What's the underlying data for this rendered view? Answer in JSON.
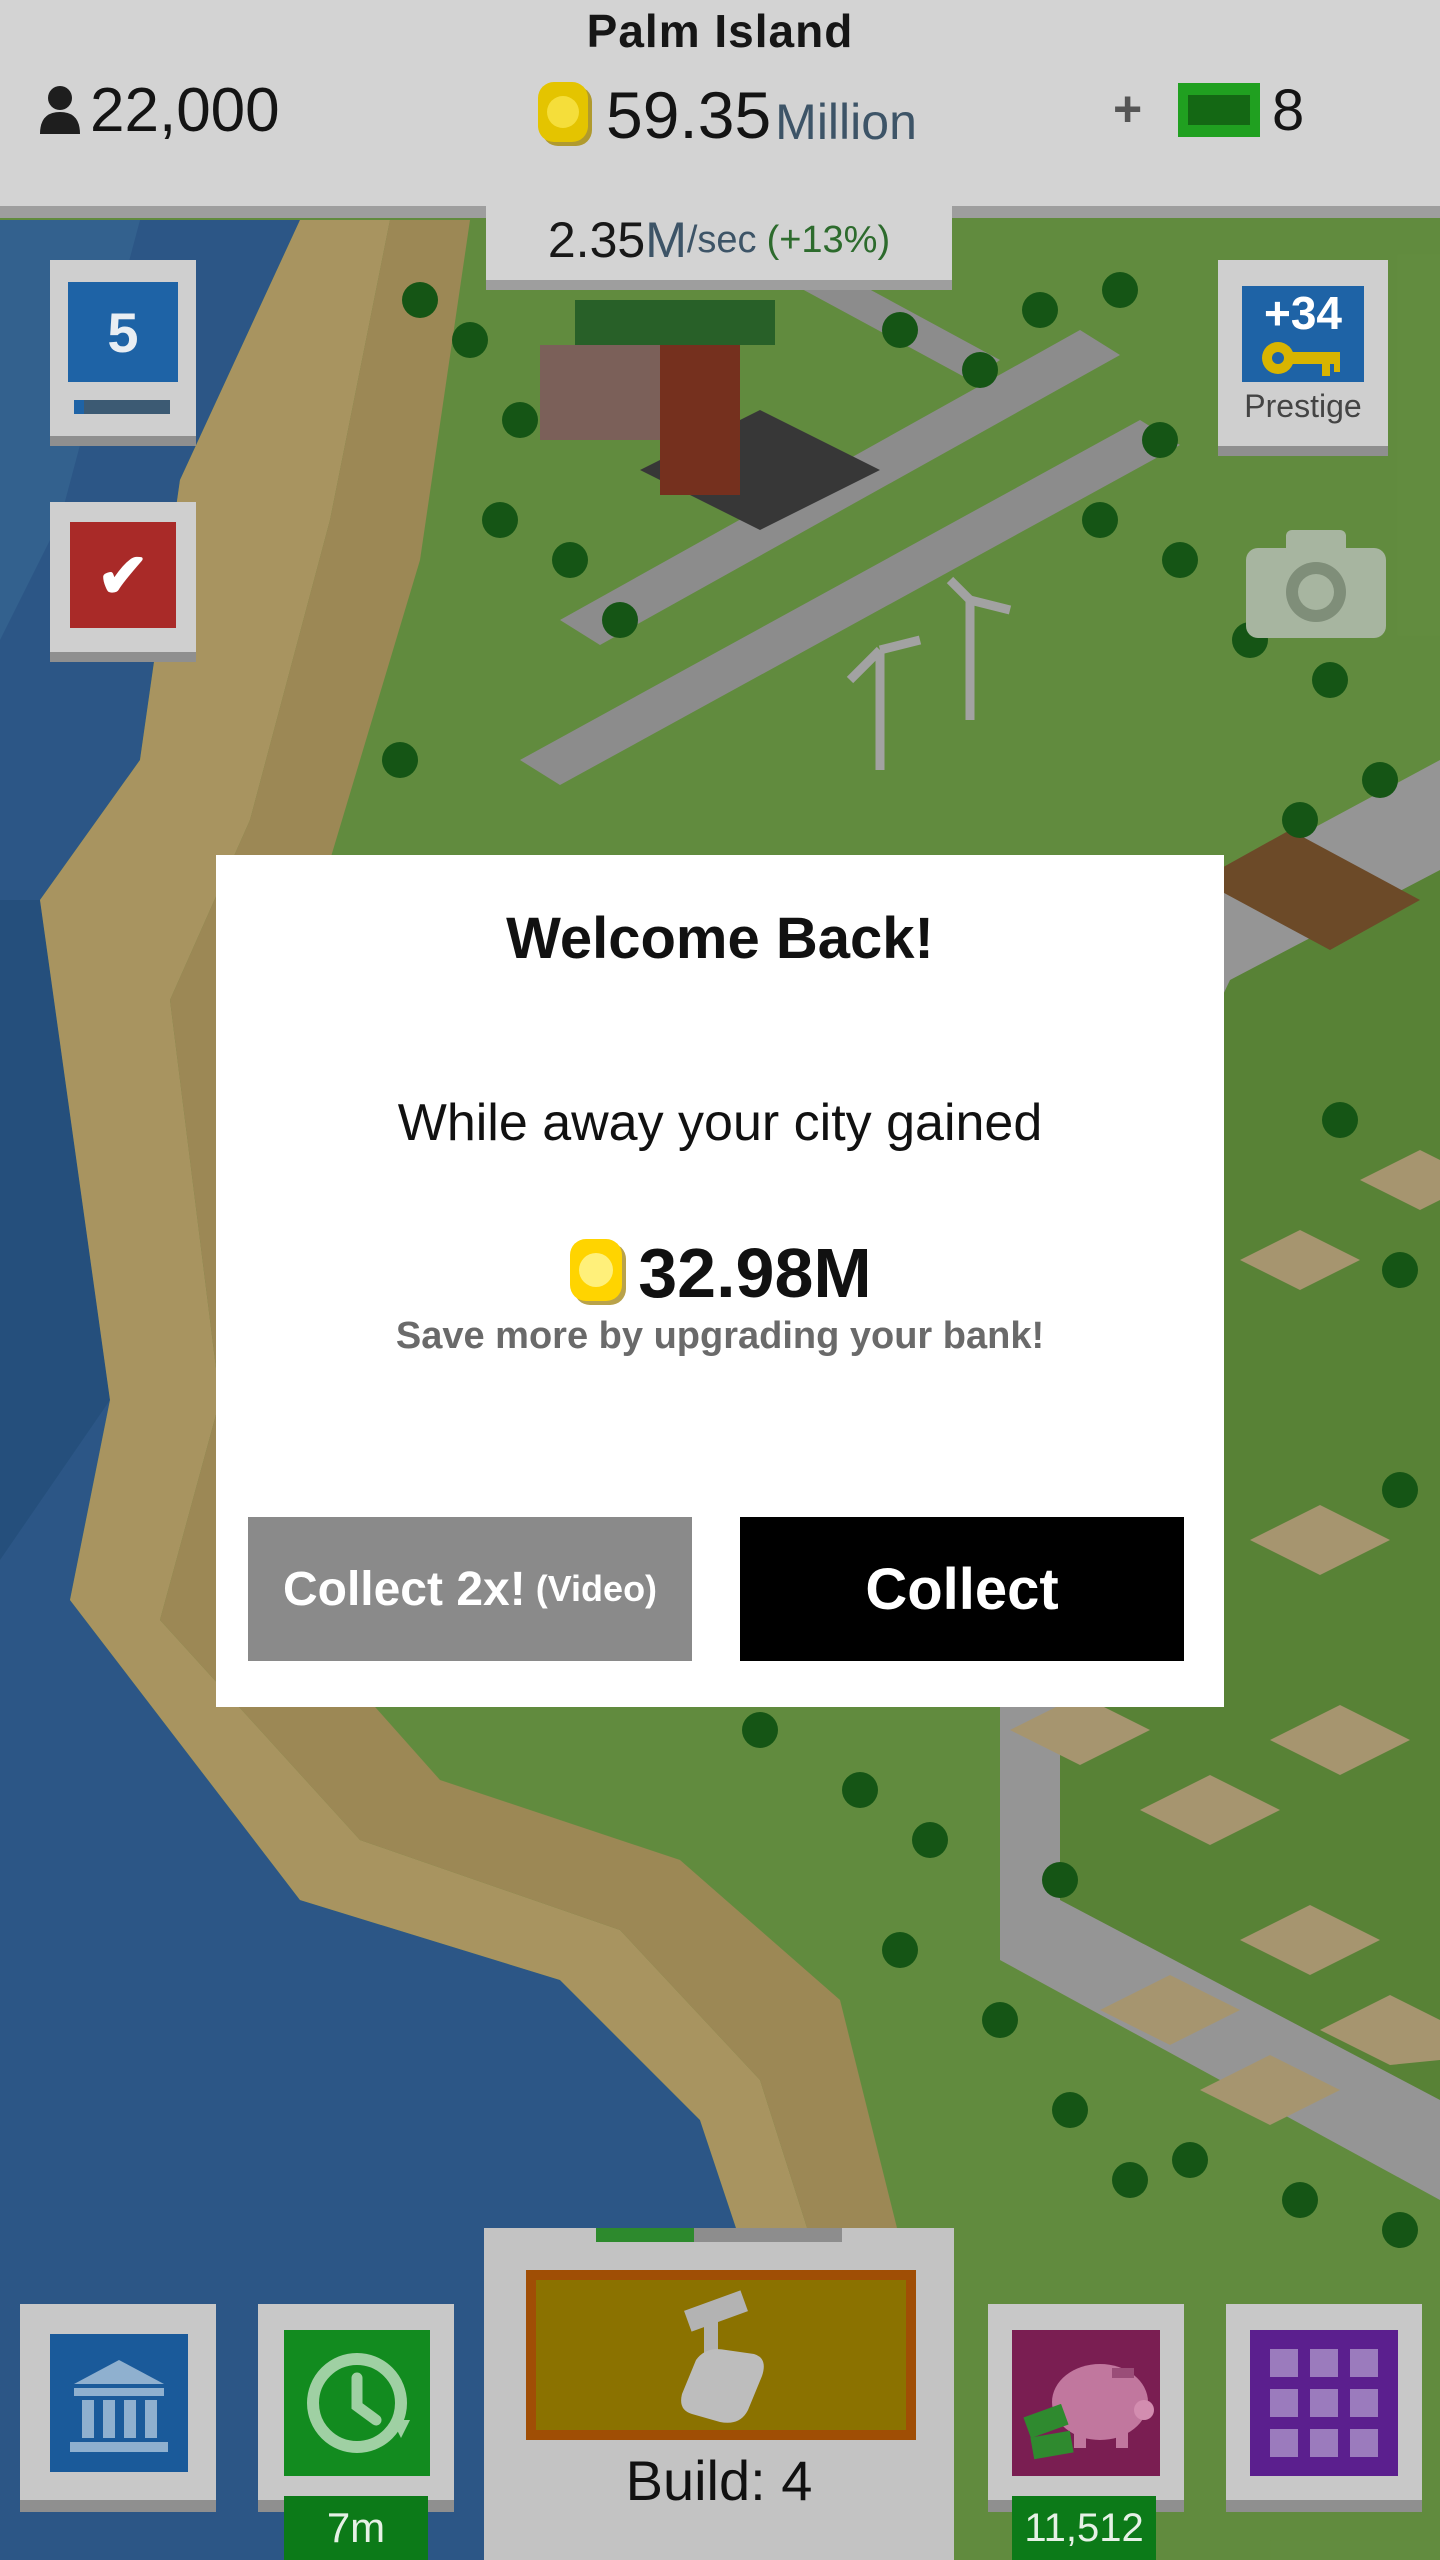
{
  "header": {
    "city_name": "Palm Island",
    "population": "22,000",
    "money_value": "59.35",
    "money_unit": "Million",
    "plus_label": "+",
    "cash_count": "8"
  },
  "income_rate": {
    "value": "2.35",
    "unit": "M",
    "per": "/sec",
    "bonus": "(+13%)"
  },
  "side_left": {
    "level": "5",
    "level_progress": 0.1,
    "tasks_icon": "checkmark-icon"
  },
  "side_right": {
    "prestige_bonus": "+34",
    "prestige_label": "Prestige",
    "camera_icon": "camera-icon"
  },
  "dialog": {
    "title": "Welcome Back!",
    "message": "While away your city gained",
    "amount": "32.98M",
    "note": "Save more by upgrading your bank!",
    "collect_video_label": "Collect 2x!",
    "collect_video_sub": "(Video)",
    "collect_label": "Collect"
  },
  "bottom_bar": {
    "bank_icon": "bank-icon",
    "timer_label": "7m",
    "build_label": "Build: 4",
    "build_progress": 0.4,
    "piggy_value": "11,512",
    "menu_icon": "grid-icon"
  },
  "colors": {
    "accent_blue": "#1e63a6",
    "accent_green": "#128b1f",
    "accent_red": "#a92a28",
    "accent_purple": "#5b1f8e",
    "dialog_bg": "#ffffff"
  }
}
